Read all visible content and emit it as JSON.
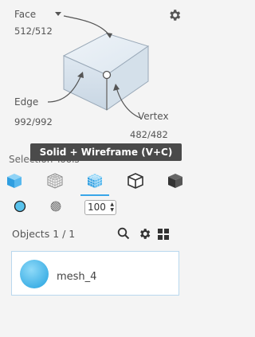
{
  "stats": {
    "face_label": "Face",
    "face_count": "512/512",
    "edge_label": "Edge",
    "edge_count": "992/992",
    "vertex_label": "Vertex",
    "vertex_count": "482/482"
  },
  "tooltip": "Solid + Wireframe (V+C)",
  "selection_tools_label": "Selection Tools",
  "point_size": {
    "value": "100"
  },
  "objects": {
    "header": "Objects 1 / 1",
    "items": [
      {
        "name": "mesh_4"
      }
    ]
  },
  "colors": {
    "accent": "#38a6e8",
    "sphere": "#59c2ec",
    "icon": "#444444"
  },
  "icons": [
    "settings-icon",
    "dropdown-caret-icon",
    "solid-cube-icon",
    "wireframe-cube-icon",
    "solid-wireframe-cube-icon",
    "outline-cube-icon",
    "flat-cube-icon",
    "color-circle-icon",
    "texture-sphere-icon",
    "search-icon",
    "filter-gear-icon",
    "grid-view-icon"
  ]
}
